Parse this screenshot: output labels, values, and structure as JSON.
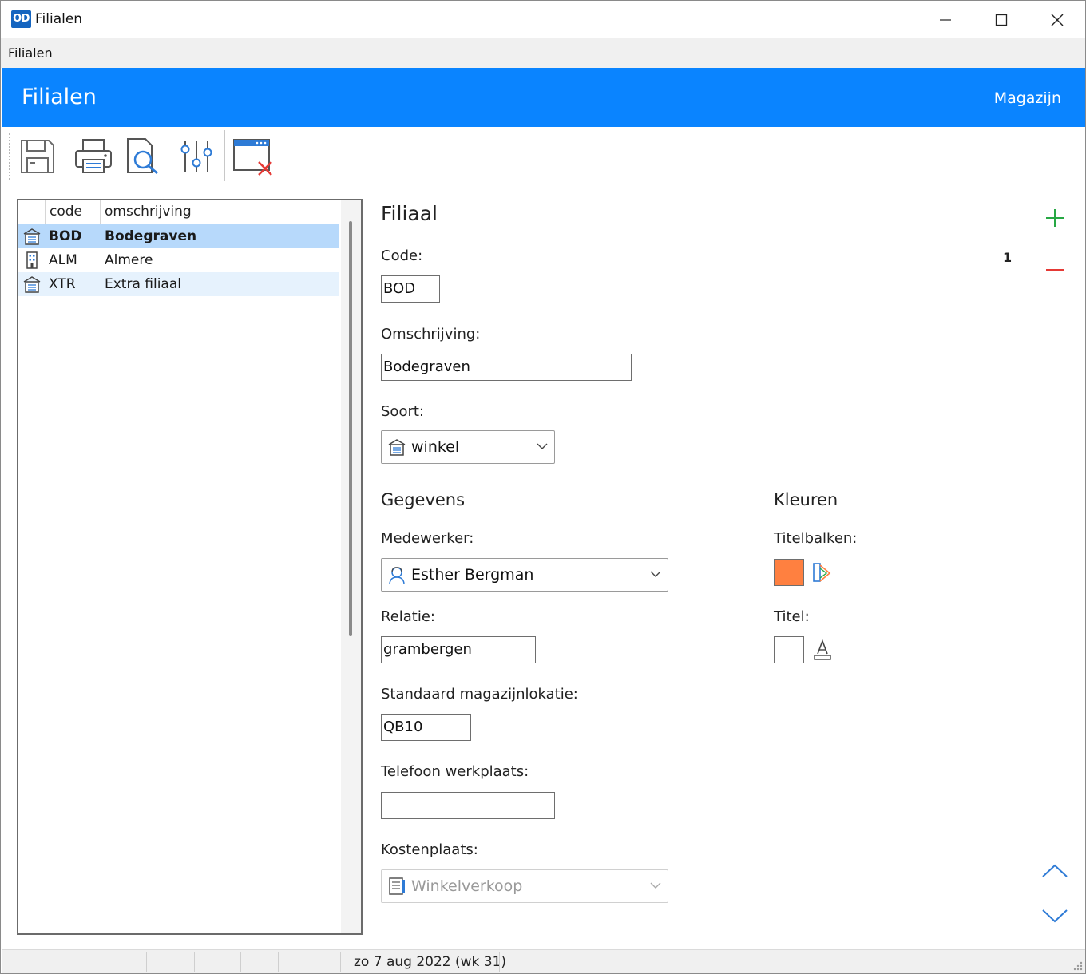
{
  "window": {
    "app_icon_text": "OD",
    "title": "Filialen"
  },
  "menubar": {
    "items": [
      "Filialen"
    ]
  },
  "header": {
    "title": "Filialen",
    "right_link": "Magazijn",
    "color": "#0a84ff"
  },
  "toolbar": {
    "buttons": [
      "save-icon",
      "print-icon",
      "print-preview-icon",
      "settings-sliders-icon",
      "close-window-icon"
    ]
  },
  "list": {
    "columns": [
      "code",
      "omschrijving"
    ],
    "rows": [
      {
        "icon": "shop-icon",
        "code": "BOD",
        "description": "Bodegraven",
        "selected": true
      },
      {
        "icon": "building-icon",
        "code": "ALM",
        "description": "Almere",
        "selected": false
      },
      {
        "icon": "shop-icon",
        "code": "XTR",
        "description": "Extra filiaal",
        "selected": false
      }
    ]
  },
  "form": {
    "title": "Filiaal",
    "record_count": "1",
    "code_label": "Code:",
    "code_value": "BOD",
    "omschrijving_label": "Omschrijving:",
    "omschrijving_value": "Bodegraven",
    "soort_label": "Soort:",
    "soort_value": "winkel",
    "gegevens_title": "Gegevens",
    "medewerker_label": "Medewerker:",
    "medewerker_value": "Esther Bergman",
    "relatie_label": "Relatie:",
    "relatie_value": "grambergen",
    "magazijnlokatie_label": "Standaard magazijnlokatie:",
    "magazijnlokatie_value": "QB10",
    "telefoon_label": "Telefoon werkplaats:",
    "telefoon_value": "",
    "kostenplaats_label": "Kostenplaats:",
    "kostenplaats_value": "Winkelverkoop",
    "kleuren_title": "Kleuren",
    "titelbalken_label": "Titelbalken:",
    "titelbalken_color": "#ff8040",
    "titel_label": "Titel:",
    "titel_color": "#ffffff"
  },
  "statusbar": {
    "date_text": "zo 7 aug 2022 (wk 31)"
  }
}
